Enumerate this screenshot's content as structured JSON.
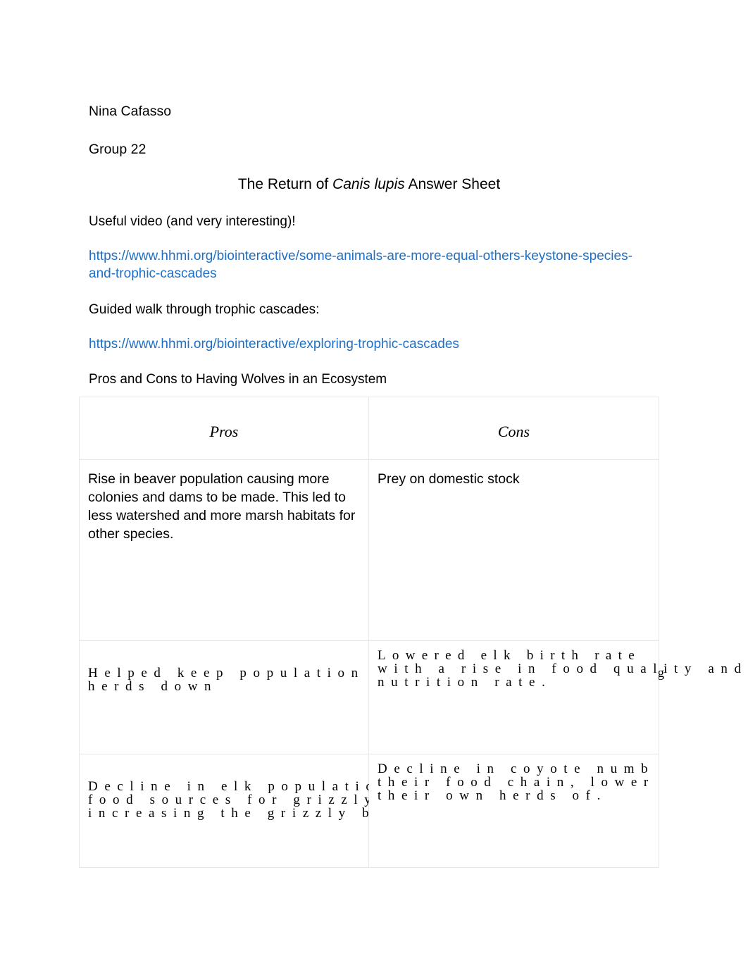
{
  "document": {
    "author": "Nina Cafasso",
    "group": "Group 22",
    "title_prefix": "The Return of ",
    "title_species": "Canis lupis",
    "title_suffix": " Answer Sheet",
    "video_intro": "Useful video (and very interesting)!",
    "link_1": "https://www.hhmi.org/biointeractive/some-animals-are-more-equal-others-keystone-species-and-trophic-cascades",
    "walk_intro": "Guided walk through trophic cascades:",
    "link_2": "https://www.hhmi.org/biointeractive/exploring-trophic-cascades",
    "table_caption": "Pros and Cons to Having Wolves in an Ecosystem"
  },
  "colors": {
    "link": "#1f6fc4",
    "text": "#000000",
    "border": "#e6e7e8",
    "background": "#ffffff"
  },
  "table": {
    "headers": {
      "pros": "Pros",
      "cons": "Cons"
    },
    "rows": [
      {
        "pros": "Rise in beaver population causing more colonies and dams to be made. This led to less watershed and more marsh habitats for other species.",
        "cons": "Prey on domestic stock"
      },
      {
        "pros_line_1": "Helped keep population numbers of large grazing",
        "pros_line_2": "herds down",
        "cons_line_1": "Lowered elk birth rate",
        "cons_line_2": "with a rise in food quality and l",
        "cons_line_3": "nutrition rate."
      },
      {
        "pros_line_1": "Decline in elk population more",
        "pros_line_2": "food sources for grizzly bears, thus",
        "pros_line_3": "increasing the grizzly bear population.",
        "cons_line_1": "Decline in coyote numb",
        "cons_line_2": "their food chain, lower",
        "cons_line_3": "their own herds of."
      }
    ]
  }
}
